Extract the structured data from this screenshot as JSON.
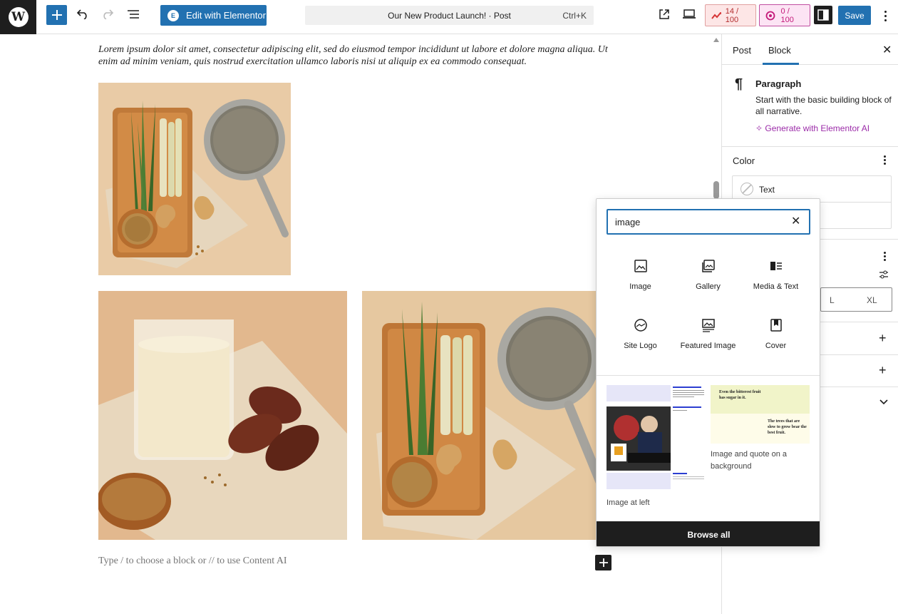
{
  "toolbar": {
    "elementor_label": "Edit with Elementor",
    "document_title": "Our New Product Launch! · Post",
    "shortcut": "Ctrl+K",
    "seo_score": "14 / 100",
    "ai_score": "0 / 100",
    "save_label": "Save"
  },
  "content": {
    "paragraph": "Lorem ipsum dolor sit amet, consectetur adipiscing elit, sed do eiusmod tempor incididunt ut labore et dolore magna aliqua. Ut enim ad minim veniam, quis nostrud exercitation ullamco laboris nisi ut aliquip ex ea commodo consequat.",
    "placeholder": "Type / to choose a block or // to use Content AI"
  },
  "sidebar": {
    "tabs": [
      "Post",
      "Block"
    ],
    "block_name": "Paragraph",
    "block_description": "Start with the basic building block of all narrative.",
    "generate_ai": "Generate with Elementor AI",
    "color_section": "Color",
    "color_text": "Text",
    "size_options": [
      "L",
      "XL"
    ]
  },
  "inserter": {
    "search_value": "image",
    "blocks": [
      {
        "label": "Image",
        "icon": "image-icon"
      },
      {
        "label": "Gallery",
        "icon": "gallery-icon"
      },
      {
        "label": "Media & Text",
        "icon": "media-text-icon"
      },
      {
        "label": "Site Logo",
        "icon": "site-logo-icon"
      },
      {
        "label": "Featured Image",
        "icon": "featured-image-icon"
      },
      {
        "label": "Cover",
        "icon": "cover-icon"
      }
    ],
    "patterns": [
      {
        "label": "Image at left"
      },
      {
        "label": "Image and quote on a background"
      }
    ],
    "pattern_quote_1": "Even the bitterest fruit has sugar in it.",
    "pattern_quote_2": "The trees that are slow to grow bear the best fruit.",
    "browse_all": "Browse all"
  },
  "colors": {
    "primary": "#2271b1",
    "dark": "#1e1e1e",
    "ai_purple": "#9b2ba8"
  }
}
